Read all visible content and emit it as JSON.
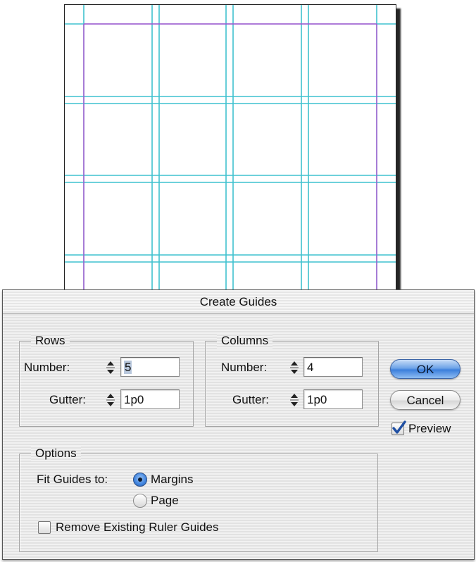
{
  "dialog": {
    "title": "Create Guides",
    "rows": {
      "legend": "Rows",
      "number_label": "Number:",
      "number_value": "5",
      "gutter_label": "Gutter:",
      "gutter_value": "1p0"
    },
    "columns": {
      "legend": "Columns",
      "number_label": "Number:",
      "number_value": "4",
      "gutter_label": "Gutter:",
      "gutter_value": "1p0"
    },
    "buttons": {
      "ok": "OK",
      "cancel": "Cancel"
    },
    "preview": {
      "label": "Preview",
      "checked": true
    },
    "options": {
      "legend": "Options",
      "fit_label": "Fit Guides to:",
      "fit_options": [
        {
          "label": "Margins",
          "selected": true
        },
        {
          "label": "Page",
          "selected": false
        }
      ],
      "remove_label": "Remove Existing Ruler Guides",
      "remove_checked": false
    }
  },
  "colors": {
    "guide": "#3fc2cf",
    "margin": "#b83fcf",
    "accent": "#3c7fdc"
  },
  "icons": [
    "stepper-icon",
    "checkmark-icon",
    "radio-icon",
    "checkbox-icon"
  ]
}
